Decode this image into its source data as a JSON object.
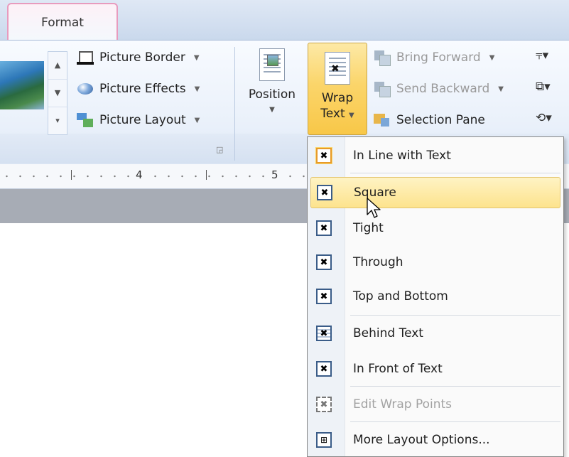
{
  "tabs": {
    "active": "Format"
  },
  "ribbon": {
    "picture_styles": {
      "border_label": "Picture Border",
      "effects_label": "Picture Effects",
      "layout_label": "Picture Layout"
    },
    "arrange": {
      "position_label": "Position",
      "wrap_label_line1": "Wrap",
      "wrap_label_line2": "Text",
      "bring_forward_label": "Bring Forward",
      "send_backward_label": "Send Backward",
      "selection_pane_label": "Selection Pane"
    }
  },
  "ruler": {
    "numbers": [
      "4",
      "5"
    ]
  },
  "wrap_menu": {
    "items": [
      {
        "label": "In Line with Text",
        "icon": "inline-wrap-icon",
        "enabled": true
      },
      {
        "label": "Square",
        "icon": "square-wrap-icon",
        "enabled": true,
        "highlighted": true
      },
      {
        "label": "Tight",
        "icon": "tight-wrap-icon",
        "enabled": true
      },
      {
        "label": "Through",
        "icon": "through-wrap-icon",
        "enabled": true
      },
      {
        "label": "Top and Bottom",
        "icon": "top-bottom-wrap-icon",
        "enabled": true
      },
      {
        "label": "Behind Text",
        "icon": "behind-text-icon",
        "enabled": true
      },
      {
        "label": "In Front of Text",
        "icon": "in-front-text-icon",
        "enabled": true
      },
      {
        "label": "Edit Wrap Points",
        "icon": "edit-wrap-points-icon",
        "enabled": false
      },
      {
        "label": "More Layout Options...",
        "icon": "layout-options-icon",
        "enabled": true
      }
    ]
  },
  "colors": {
    "highlight": "#fde38d",
    "tab_border": "#e89bbe",
    "ribbon_bg": "#e9f0fa"
  }
}
